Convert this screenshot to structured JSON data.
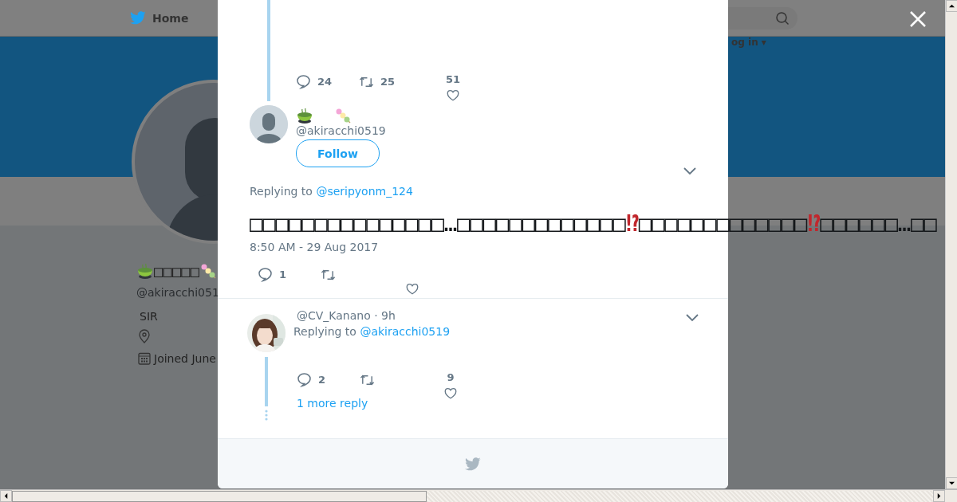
{
  "background_page": {
    "nav": {
      "home": "Home",
      "login": "og in ▾"
    },
    "profile": {
      "name": "□□□□□",
      "handle": "@akiracchi051",
      "bio": "SIR",
      "joined": "Joined June"
    }
  },
  "modal": {
    "parent_tweet": {
      "replies": "24",
      "retweets": "25",
      "likes": "51"
    },
    "tweet": {
      "handle": "@akiracchi0519",
      "follow_label": "Follow",
      "replying_label": "Replying to",
      "replying_to": "@seripyonm_124",
      "text": [
        {
          "kind": "plain",
          "text": "□□□□□□□□□□□□□□□…□□□□□□□□□□□□□"
        },
        {
          "kind": "emphasis",
          "text": "⁉"
        },
        {
          "kind": "plain",
          "text": "□□□□□□□□□□□□□"
        },
        {
          "kind": "emphasis",
          "text": "⁉"
        },
        {
          "kind": "plain",
          "text": "□□□□□□…□□"
        }
      ],
      "timestamp": "8:50 AM - 29 Aug 2017",
      "replies": "1"
    },
    "reply": {
      "author": "@CV_Kanano · 9h",
      "replying_label": "Replying to",
      "replying_to": "@akiracchi0519",
      "replies": "2",
      "likes": "9",
      "more_replies": "1 more reply"
    }
  }
}
